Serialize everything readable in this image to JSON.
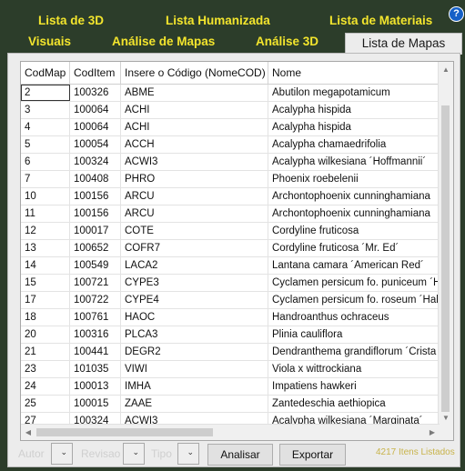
{
  "tabs": {
    "row1": [
      {
        "label": "Lista de 3D"
      },
      {
        "label": "Lista Humanizada"
      },
      {
        "label": "Lista de Materiais"
      }
    ],
    "row2": [
      {
        "label": "Visuais"
      },
      {
        "label": "Análise de Mapas"
      },
      {
        "label": "Análise 3D"
      },
      {
        "label": "Lista de Mapas",
        "active": true
      }
    ]
  },
  "help": {
    "label": "?"
  },
  "grid": {
    "columns": [
      "CodMap",
      "CodItem",
      "Insere o Código (NomeCOD)",
      "Nome"
    ],
    "rows": [
      [
        "2",
        "100326",
        "ABME",
        "Abutilon megapotamicum"
      ],
      [
        "3",
        "100064",
        "ACHI",
        "Acalypha hispida"
      ],
      [
        "4",
        "100064",
        "ACHI",
        "Acalypha hispida"
      ],
      [
        "5",
        "100054",
        "ACCH",
        "Acalypha chamaedrifolia"
      ],
      [
        "6",
        "100324",
        "ACWI3",
        "Acalypha wilkesiana ´Hoffmannii´"
      ],
      [
        "7",
        "100408",
        "PHRO",
        "Phoenix roebelenii"
      ],
      [
        "10",
        "100156",
        "ARCU",
        "Archontophoenix cunninghamiana"
      ],
      [
        "11",
        "100156",
        "ARCU",
        "Archontophoenix cunninghamiana"
      ],
      [
        "12",
        "100017",
        "COTE",
        "Cordyline fruticosa"
      ],
      [
        "13",
        "100652",
        "COFR7",
        "Cordyline fruticosa ´Mr. Ed´"
      ],
      [
        "14",
        "100549",
        "LACA2",
        "Lantana camara ´American Red´"
      ],
      [
        "15",
        "100721",
        "CYPE3",
        "Cyclamen persicum fo. puniceum ´H"
      ],
      [
        "17",
        "100722",
        "CYPE4",
        "Cyclamen persicum fo. roseum ´Hal"
      ],
      [
        "18",
        "100761",
        "HAOC",
        "Handroanthus ochraceus"
      ],
      [
        "20",
        "100316",
        "PLCA3",
        "Plinia cauliflora"
      ],
      [
        "21",
        "100441",
        "DEGR2",
        "Dendranthema grandiflorum ´Crista"
      ],
      [
        "23",
        "101035",
        "VIWI",
        "Viola x wittrockiana"
      ],
      [
        "24",
        "100013",
        "IMHA",
        "Impatiens hawkeri"
      ],
      [
        "25",
        "100015",
        "ZAAE",
        "Zantedeschia aethiopica"
      ],
      [
        "27",
        "100324",
        "ACWI3",
        "Acalypha wilkesiana ´Marginata´"
      ]
    ]
  },
  "bottom": {
    "autor_label": "Autor",
    "revisao_label": "Revisao",
    "tipo_label": "Tipo",
    "analisar_label": "Analisar",
    "exportar_label": "Exportar",
    "count_text": "4217 Itens Listados"
  },
  "colors": {
    "background": "#2c3d2a",
    "tab_text": "#f3e52d",
    "count_text": "#c8b34a",
    "help_icon": "#1560c7"
  },
  "icons": [
    "help-icon",
    "chevron-down-icon",
    "scroll-up-icon",
    "scroll-down-icon",
    "scroll-left-icon",
    "scroll-right-icon"
  ]
}
